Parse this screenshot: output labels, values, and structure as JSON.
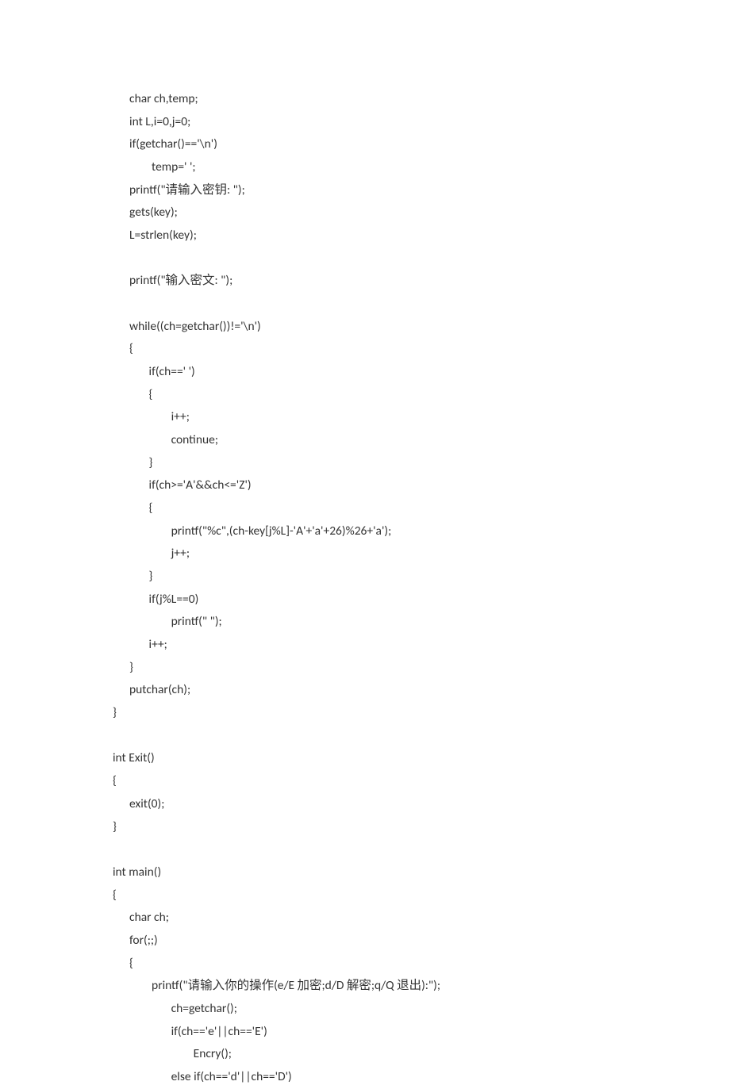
{
  "code": "      char ch,temp;\n      int L,i=0,j=0;\n      if(getchar()=='\\n')\n              temp=' ';\n      printf(\"请输入密钥: \");\n      gets(key);\n      L=strlen(key);\n\n      printf(\"输入密文: \");\n\n      while((ch=getchar())!='\\n')\n      {\n             if(ch==' ')\n             {\n                     i++;\n                     continue;\n             }\n             if(ch>='A'&&ch<='Z')\n             {\n                     printf(\"%c\",(ch-key[j%L]-'A'+'a'+26)%26+'a');\n                     j++;\n             }\n             if(j%L==0)\n                     printf(\" \");\n             i++;\n      }\n      putchar(ch);\n}\n\nint Exit()\n{\n      exit(0);\n}\n\nint main()\n{\n      char ch;\n      for(;;)\n      {\n              printf(\"请输入你的操作(e/E 加密;d/D 解密;q/Q 退出):\");\n                     ch=getchar();\n                     if(ch=='e'||ch=='E')\n                             Encry();\n                     else if(ch=='d'||ch=='D')"
}
